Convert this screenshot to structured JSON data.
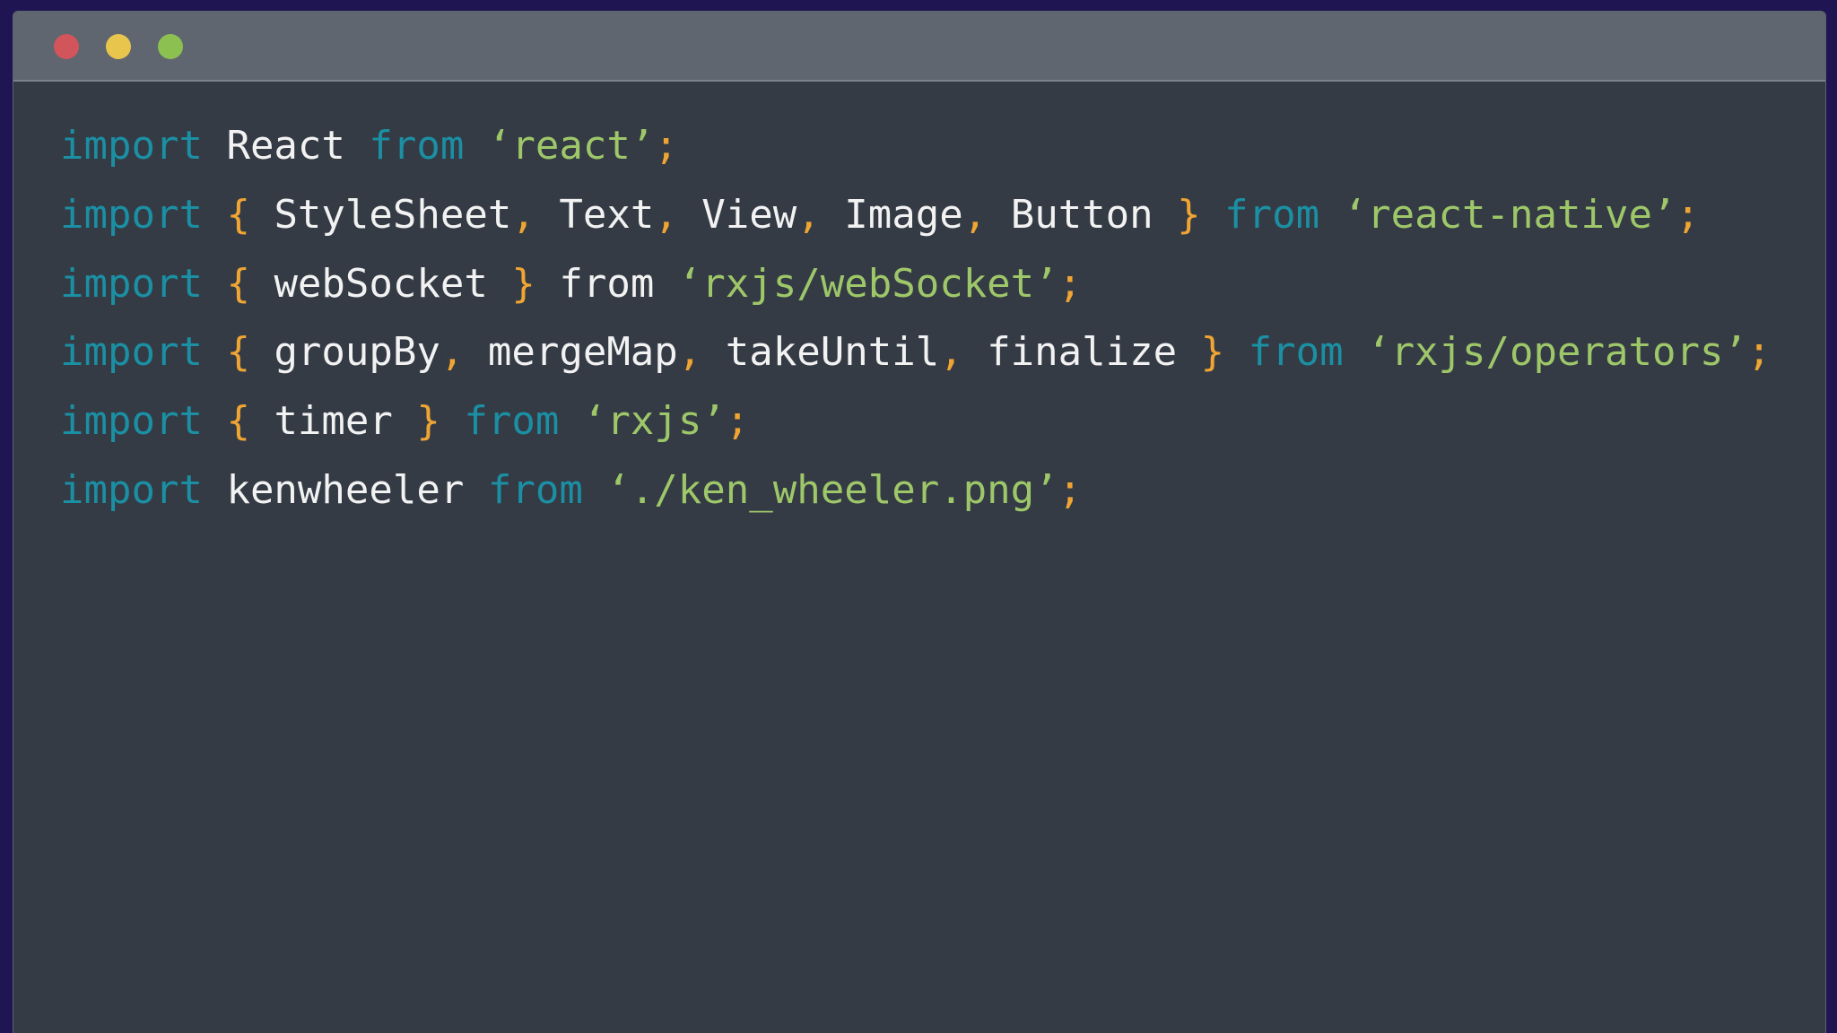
{
  "window": {
    "buttons": [
      {
        "name": "close",
        "color": "#d2555b"
      },
      {
        "name": "minimize",
        "color": "#e8c64e"
      },
      {
        "name": "maximize",
        "color": "#8cc152"
      }
    ]
  },
  "theme": {
    "keyword_color": "#1b8fa3",
    "string_color": "#9ec769",
    "punctuation_color": "#f0a533",
    "identifier_color": "#f2f2f2",
    "background": "#343b45",
    "titlebar": "#5f666f"
  },
  "code": {
    "lines": [
      [
        {
          "t": "import",
          "c": "kw"
        },
        {
          "t": " ",
          "c": "id"
        },
        {
          "t": "React",
          "c": "id"
        },
        {
          "t": " ",
          "c": "id"
        },
        {
          "t": "from",
          "c": "kw"
        },
        {
          "t": " ",
          "c": "id"
        },
        {
          "t": "‘react’",
          "c": "str"
        },
        {
          "t": ";",
          "c": "pn"
        }
      ],
      [
        {
          "t": "import",
          "c": "kw"
        },
        {
          "t": " ",
          "c": "id"
        },
        {
          "t": "{",
          "c": "pn"
        },
        {
          "t": " StyleSheet",
          "c": "id"
        },
        {
          "t": ",",
          "c": "pn"
        },
        {
          "t": " Text",
          "c": "id"
        },
        {
          "t": ",",
          "c": "pn"
        },
        {
          "t": " View",
          "c": "id"
        },
        {
          "t": ",",
          "c": "pn"
        },
        {
          "t": " Image",
          "c": "id"
        },
        {
          "t": ",",
          "c": "pn"
        },
        {
          "t": " Button ",
          "c": "id"
        },
        {
          "t": "}",
          "c": "pn"
        },
        {
          "t": " ",
          "c": "id"
        },
        {
          "t": "from",
          "c": "kw"
        },
        {
          "t": " ",
          "c": "id"
        },
        {
          "t": "‘react-native’",
          "c": "str"
        },
        {
          "t": ";",
          "c": "pn"
        }
      ],
      [
        {
          "t": "import",
          "c": "kw"
        },
        {
          "t": " ",
          "c": "id"
        },
        {
          "t": "{",
          "c": "pn"
        },
        {
          "t": " webSocket ",
          "c": "id"
        },
        {
          "t": "}",
          "c": "pn"
        },
        {
          "t": " from ",
          "c": "id"
        },
        {
          "t": "‘rxjs/webSocket’",
          "c": "str"
        },
        {
          "t": ";",
          "c": "pn"
        }
      ],
      [
        {
          "t": "import",
          "c": "kw"
        },
        {
          "t": " ",
          "c": "id"
        },
        {
          "t": "{",
          "c": "pn"
        },
        {
          "t": " groupBy",
          "c": "id"
        },
        {
          "t": ",",
          "c": "pn"
        },
        {
          "t": " mergeMap",
          "c": "id"
        },
        {
          "t": ",",
          "c": "pn"
        },
        {
          "t": " takeUntil",
          "c": "id"
        },
        {
          "t": ",",
          "c": "pn"
        },
        {
          "t": " finalize ",
          "c": "id"
        },
        {
          "t": "}",
          "c": "pn"
        },
        {
          "t": " ",
          "c": "id"
        },
        {
          "t": "from",
          "c": "kw"
        },
        {
          "t": " ",
          "c": "id"
        },
        {
          "t": "‘rxjs/operators’",
          "c": "str"
        },
        {
          "t": ";",
          "c": "pn"
        }
      ],
      [
        {
          "t": "import",
          "c": "kw"
        },
        {
          "t": " ",
          "c": "id"
        },
        {
          "t": "{",
          "c": "pn"
        },
        {
          "t": " timer ",
          "c": "id"
        },
        {
          "t": "}",
          "c": "pn"
        },
        {
          "t": " ",
          "c": "id"
        },
        {
          "t": "from",
          "c": "kw"
        },
        {
          "t": " ",
          "c": "id"
        },
        {
          "t": "‘rxjs’",
          "c": "str"
        },
        {
          "t": ";",
          "c": "pn"
        }
      ],
      [
        {
          "t": "import",
          "c": "kw"
        },
        {
          "t": " ",
          "c": "id"
        },
        {
          "t": "kenwheeler",
          "c": "id"
        },
        {
          "t": " ",
          "c": "id"
        },
        {
          "t": "from",
          "c": "kw"
        },
        {
          "t": " ",
          "c": "id"
        },
        {
          "t": "‘./ken_wheeler.png’",
          "c": "str"
        },
        {
          "t": ";",
          "c": "pn"
        }
      ]
    ]
  }
}
